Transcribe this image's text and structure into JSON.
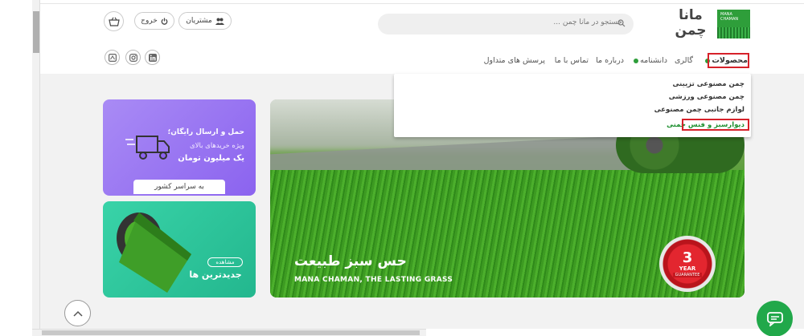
{
  "header": {
    "logo": {
      "text_line1": "مانا",
      "text_line2": "چمن",
      "mark_text": "MANA CHAMAN"
    },
    "search": {
      "placeholder": "جستجو در مانا چمن ..."
    },
    "buttons": {
      "customers": "مشتریان",
      "logout": "خروج"
    },
    "social": [
      "linkedin-icon",
      "instagram-icon",
      "site-icon"
    ]
  },
  "nav": {
    "items": [
      "محصولات",
      "گالری",
      "دانشنامه",
      "درباره ما",
      "تماس‌ با ما",
      "پرسش های متداول"
    ]
  },
  "dropdown": {
    "items": [
      "چمن مصنوعی تزیینی",
      "چمن مصنوعی ورزشی",
      "لوازم جانبی چمن مصنوعی",
      "دیوارسبز و فنس چمنی"
    ]
  },
  "cards": {
    "delivery": {
      "line1": "حمل و ارسال رایگان؛",
      "line2": "ویژه خریدهای بالای",
      "line3": "یک میلیون تومان",
      "footer": "به سراسر کشور"
    },
    "newest": {
      "badge": "مشاهده",
      "title": "جدیدترین ها"
    }
  },
  "hero": {
    "title": "حس سبز طبیعت",
    "subtitle": "MANA CHAMAN, THE LASTING GRASS",
    "seal_number": "3",
    "seal_label": "YEAR",
    "seal_tag": "GUARANTEE"
  },
  "colors": {
    "brand": "#2e9e3a",
    "highlight": "#d6212a",
    "delivery_card": "#8b63ef",
    "newest_card": "#23b78e",
    "chat": "#21a84a"
  }
}
